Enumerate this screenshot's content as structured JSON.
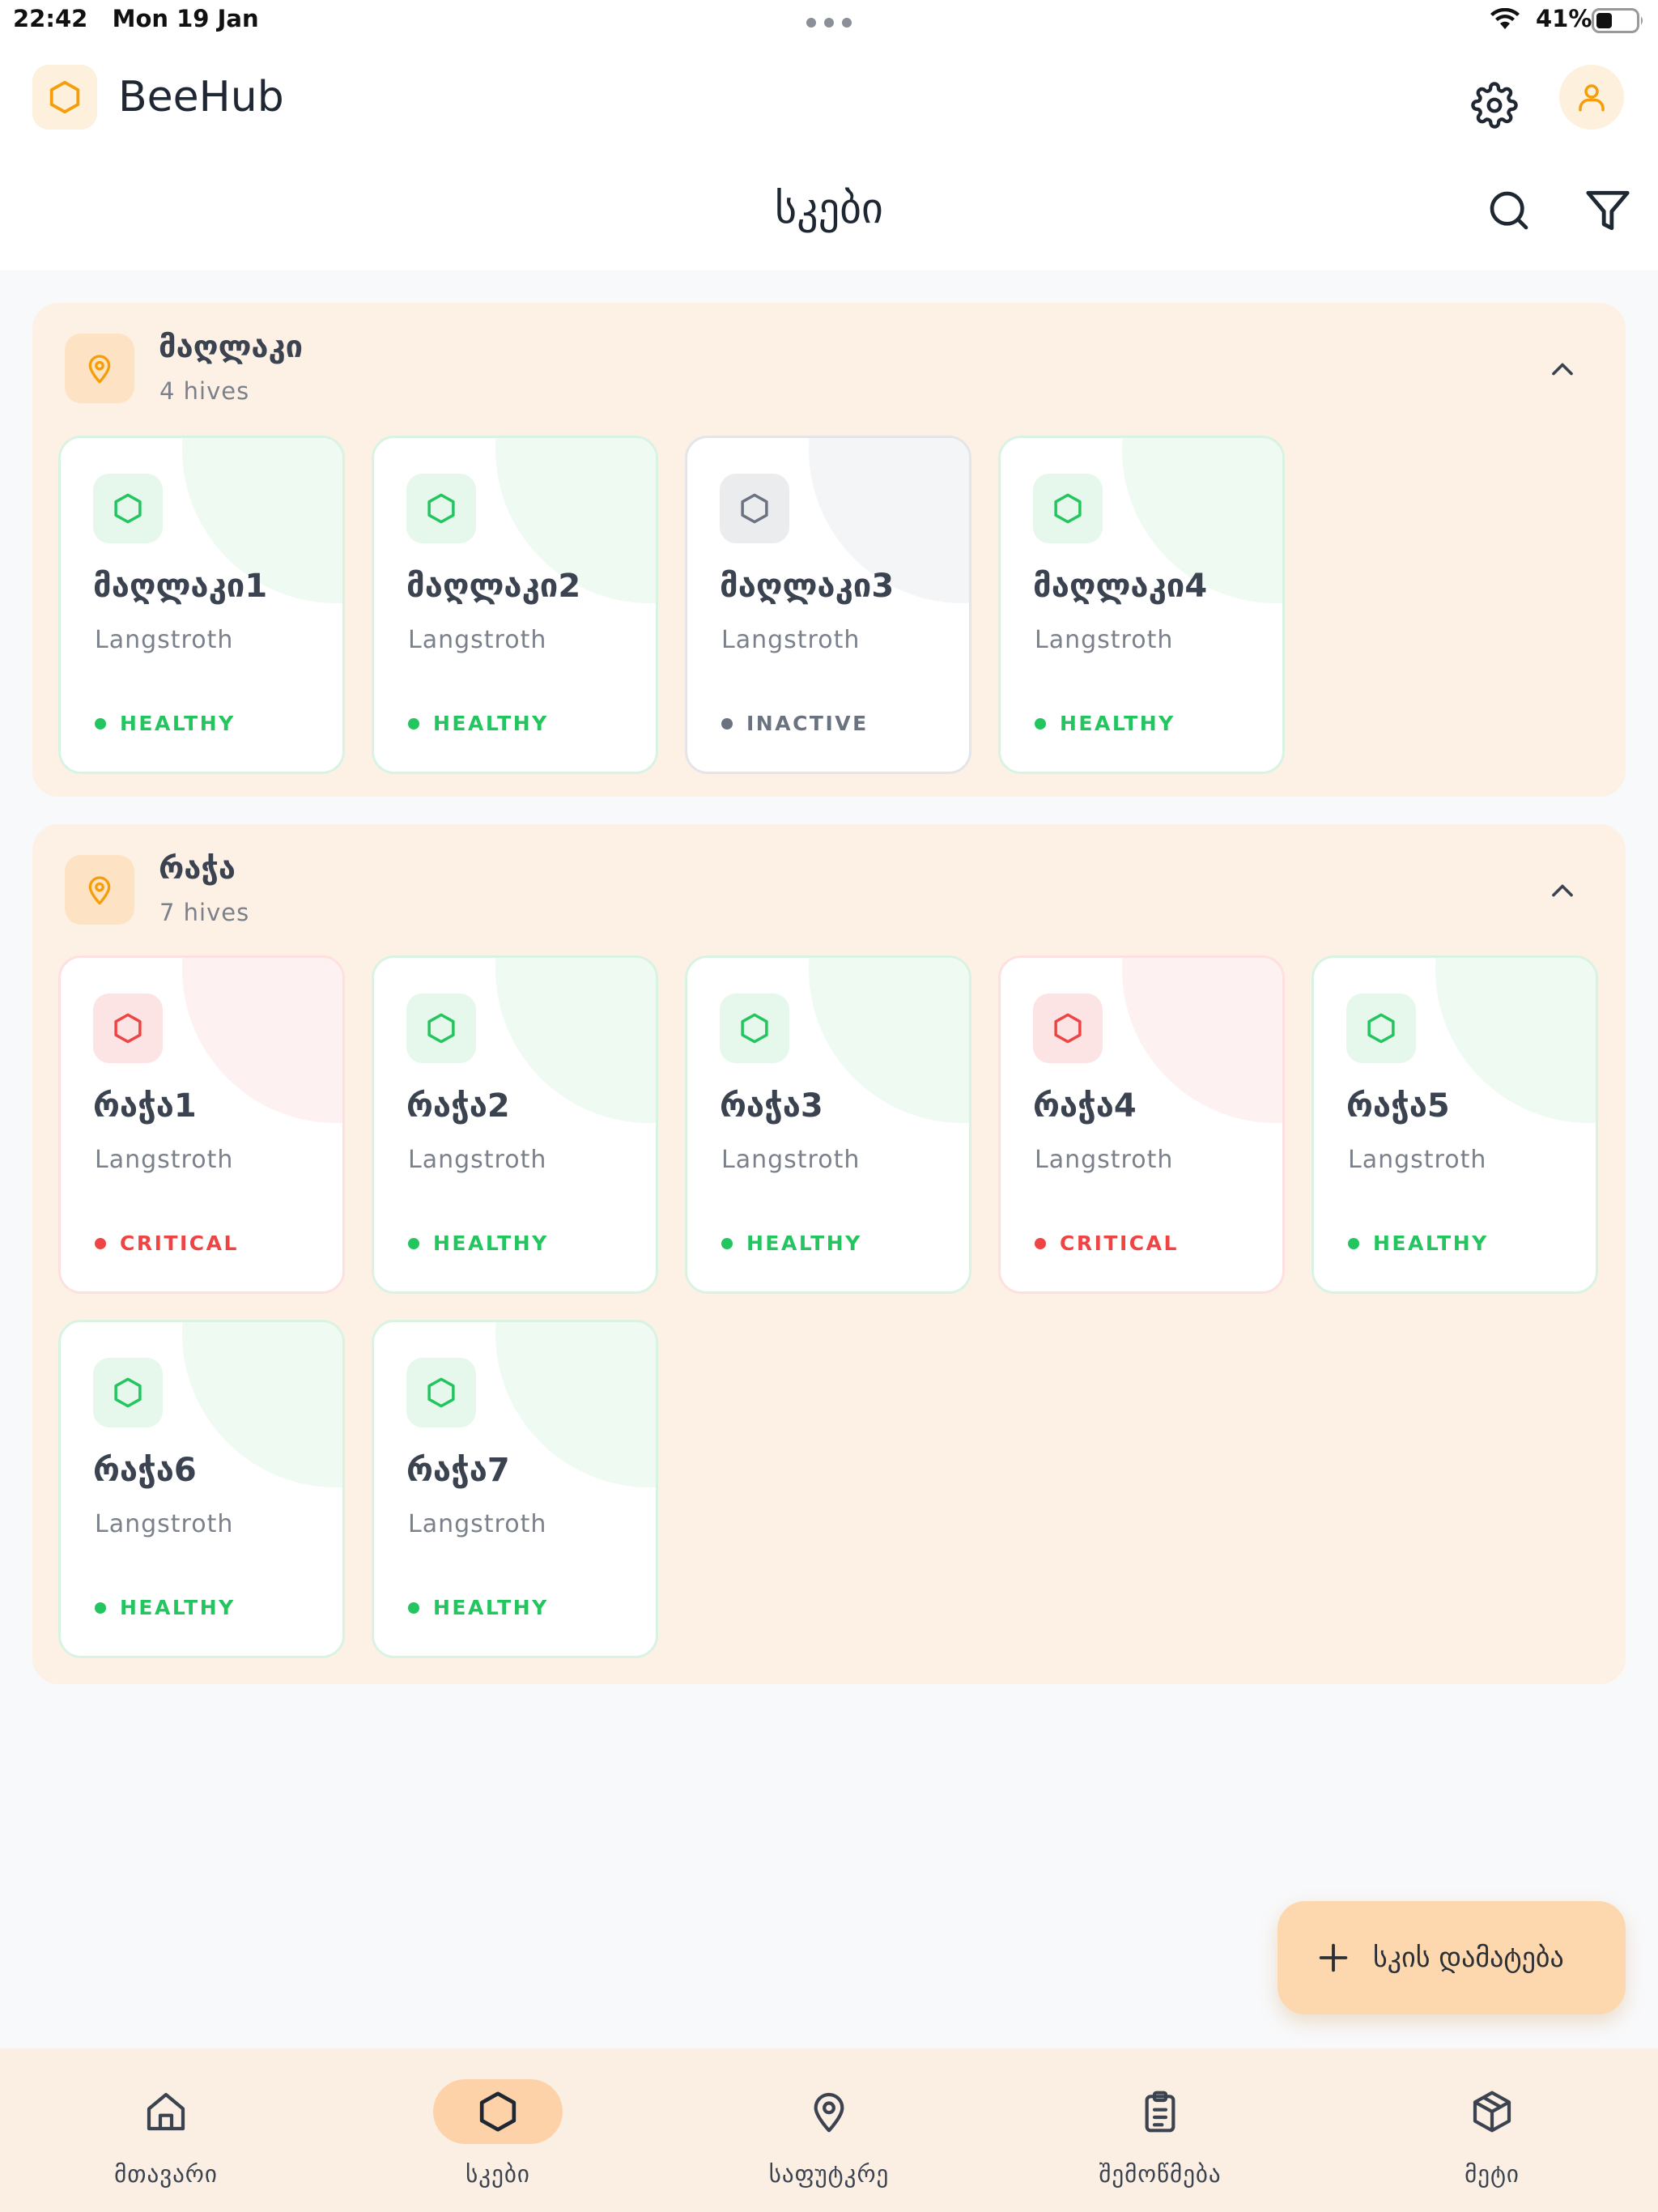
{
  "status_bar": {
    "time": "22:42",
    "date": "Mon 19 Jan",
    "battery": "41%",
    "battery_level": 0.41
  },
  "header": {
    "app_name": "BeeHub",
    "page_title": "სკები",
    "icons": [
      "hexagon-logo-icon",
      "gear-icon",
      "user-icon",
      "search-icon",
      "filter-icon"
    ]
  },
  "colors": {
    "accent": "#f59e0b",
    "healthy": "#22c55e",
    "critical": "#ef4444",
    "inactive": "#6b7280",
    "group_background": "#fdf0e4"
  },
  "locations": [
    {
      "name": "მაღლაკი",
      "count": "4 hives",
      "hives": [
        {
          "name": "მაღლაკი1",
          "type": "Langstroth",
          "status": "HEALTHY",
          "state": "healthy"
        },
        {
          "name": "მაღლაკი2",
          "type": "Langstroth",
          "status": "HEALTHY",
          "state": "healthy"
        },
        {
          "name": "მაღლაკი3",
          "type": "Langstroth",
          "status": "INACTIVE",
          "state": "inactive"
        },
        {
          "name": "მაღლაკი4",
          "type": "Langstroth",
          "status": "HEALTHY",
          "state": "healthy"
        }
      ]
    },
    {
      "name": "რაჭა",
      "count": "7 hives",
      "hives": [
        {
          "name": "რაჭა1",
          "type": "Langstroth",
          "status": "CRITICAL",
          "state": "critical"
        },
        {
          "name": "რაჭა2",
          "type": "Langstroth",
          "status": "HEALTHY",
          "state": "healthy"
        },
        {
          "name": "რაჭა3",
          "type": "Langstroth",
          "status": "HEALTHY",
          "state": "healthy"
        },
        {
          "name": "რაჭა4",
          "type": "Langstroth",
          "status": "CRITICAL",
          "state": "critical"
        },
        {
          "name": "რაჭა5",
          "type": "Langstroth",
          "status": "HEALTHY",
          "state": "healthy"
        },
        {
          "name": "რაჭა6",
          "type": "Langstroth",
          "status": "HEALTHY",
          "state": "healthy"
        },
        {
          "name": "რაჭა7",
          "type": "Langstroth",
          "status": "HEALTHY",
          "state": "healthy"
        }
      ]
    }
  ],
  "fab": {
    "label": "სკის დამატება",
    "icon": "plus-icon"
  },
  "bottom_nav": [
    {
      "label": "მთავარი",
      "icon": "home-icon",
      "active": false
    },
    {
      "label": "სკები",
      "icon": "hexagon-icon",
      "active": true
    },
    {
      "label": "საფუტკრე",
      "icon": "map-pin-icon",
      "active": false
    },
    {
      "label": "შემოწმება",
      "icon": "clipboard-icon",
      "active": false
    },
    {
      "label": "მეტი",
      "icon": "box-icon",
      "active": false
    }
  ]
}
